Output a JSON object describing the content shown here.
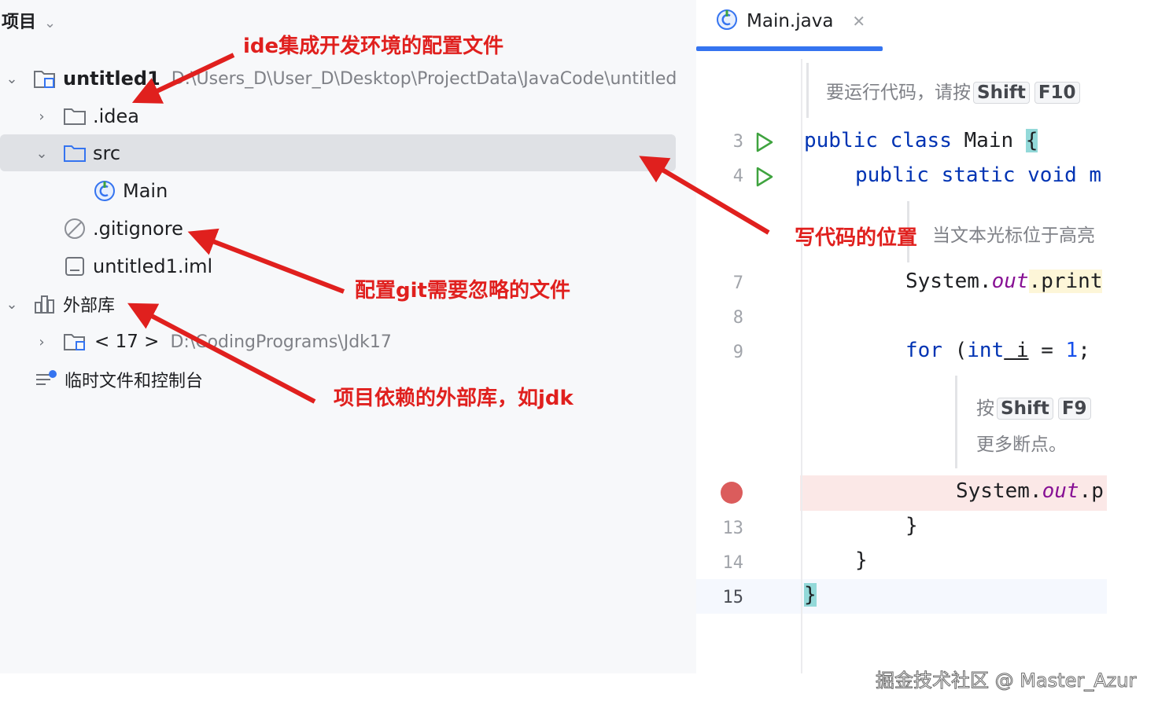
{
  "project_panel": {
    "title": "项目",
    "tree": {
      "root_name": "untitled1",
      "root_path": "D:\\Users_D\\User_D\\Desktop\\ProjectData\\JavaCode\\untitled",
      "idea": ".idea",
      "src": "src",
      "main": "Main",
      "gitignore": ".gitignore",
      "iml": "untitled1.iml",
      "ext_libs": "外部库",
      "jdk_label": "< 17 >",
      "jdk_path": "D:\\CodingPrograms\\Jdk17",
      "scratches": "临时文件和控制台"
    }
  },
  "editor": {
    "tab_label": "Main.java",
    "run_hint": {
      "text": "要运行代码，请按",
      "key1": "Shift",
      "key2": "F10"
    },
    "caret_hint": "当文本光标位于高亮",
    "debug_hint": {
      "prefix": "按",
      "key1": "Shift",
      "key2": "F9",
      "line2": "更多断点。"
    },
    "lines": {
      "l3": "3",
      "l4": "4",
      "l7": "7",
      "l8": "8",
      "l9": "9",
      "l13": "13",
      "l14": "14",
      "l15": "15"
    },
    "code": {
      "kw_public": "public",
      "kw_class": "class",
      "class_name": " Main ",
      "open_brace": "{",
      "kw_public_static_void": "public static void",
      "method_start": " m",
      "sys1_prefix": "System.",
      "sys1_out": "out",
      "sys1_suffix": ".print",
      "kw_for": "for",
      "for_open": " (",
      "kw_int": "int",
      "var_i": " i",
      "assign": " = ",
      "num1": "1",
      "semi": ";",
      "sys2_prefix": "System.",
      "sys2_out": "out",
      "sys2_suffix": ".p",
      "close_brace": "}"
    }
  },
  "annotations": {
    "ide_config": "ide集成开发环境的配置文件",
    "code_location": "写代码的位置",
    "git_ignore": "配置git需要忽略的文件",
    "external_libs": "项目依赖的外部库，如jdk"
  },
  "watermark": "掘金技术社区 @ Master_Azur",
  "colors": {
    "annotation": "#e0201e",
    "tab_underline": "#3574f0",
    "keyword": "#0033b3",
    "field": "#871094",
    "number": "#1750eb",
    "run_icon": "#3fa33f",
    "breakpoint": "#db5c5c",
    "selection": "#dfe1e5"
  }
}
